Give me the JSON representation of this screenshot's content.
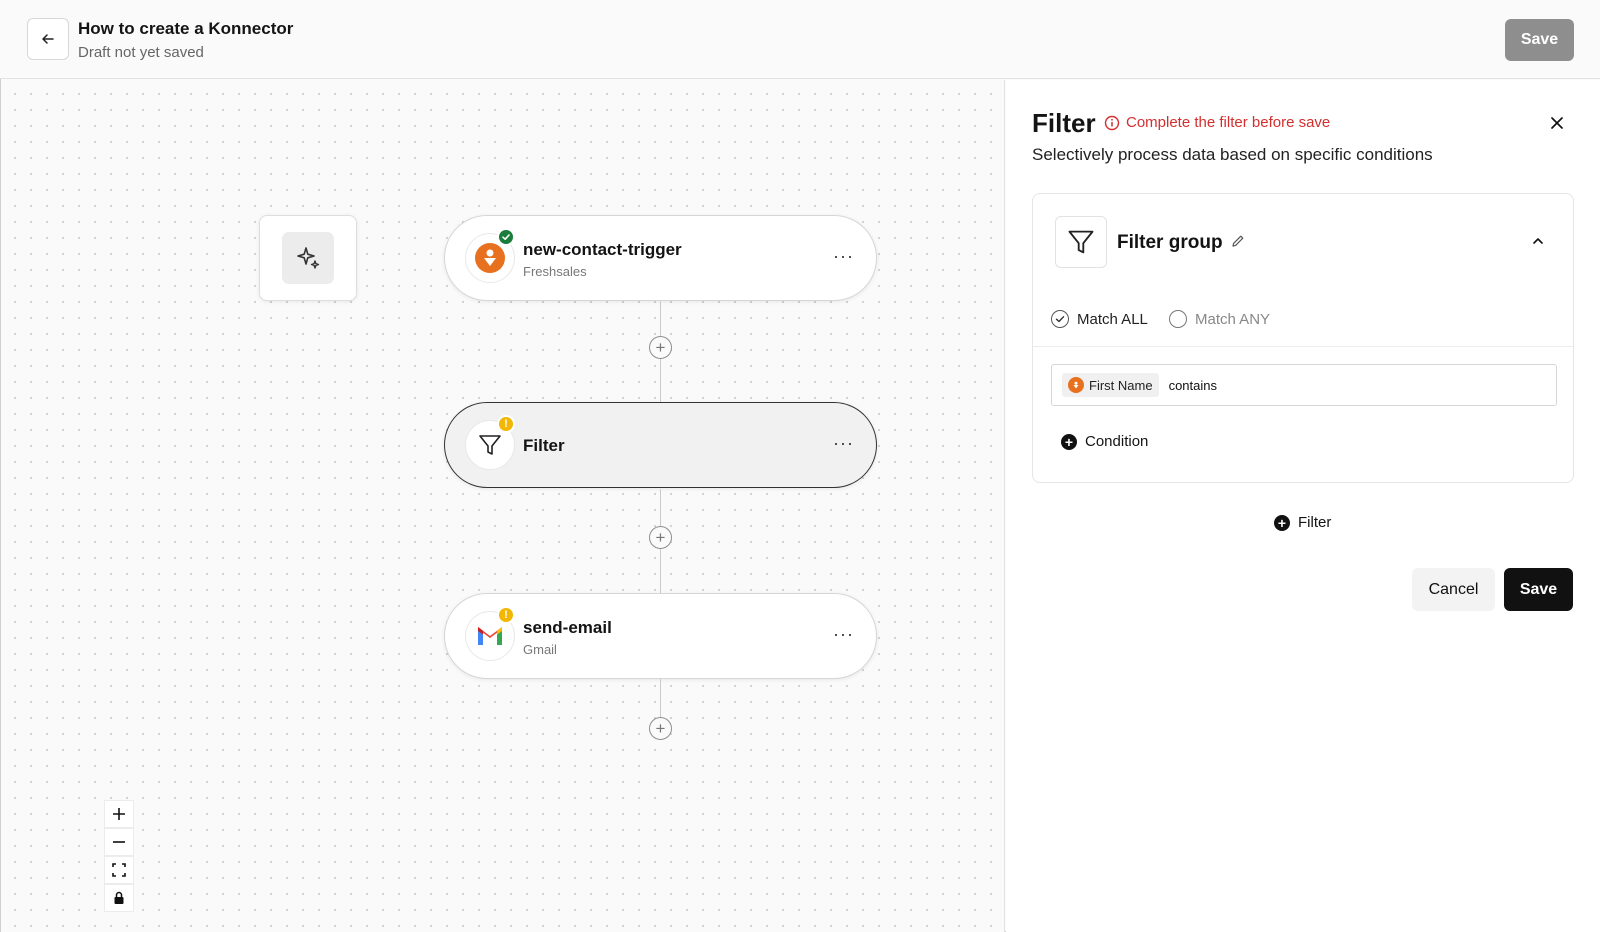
{
  "header": {
    "title": "How to create a Konnector",
    "subtitle": "Draft not yet saved",
    "save_label": "Save"
  },
  "canvas": {
    "nodes": [
      {
        "title": "new-contact-trigger",
        "app": "Freshsales",
        "status": "ok",
        "icon": "freshsales-icon"
      },
      {
        "title": "Filter",
        "app": "",
        "status": "warning",
        "icon": "filter-icon"
      },
      {
        "title": "send-email",
        "app": "Gmail",
        "status": "warning",
        "icon": "gmail-icon"
      }
    ],
    "menu_glyph": "···",
    "zoom_controls": [
      "zoom-in",
      "zoom-out",
      "fit-view",
      "lock"
    ]
  },
  "panel": {
    "title": "Filter",
    "warning": "Complete the filter before save",
    "description": "Selectively process data based on specific conditions",
    "group": {
      "title": "Filter group",
      "match_all_label": "Match ALL",
      "match_any_label": "Match ANY",
      "selected_match": "all",
      "condition": {
        "field": "First Name",
        "operator": "contains",
        "value": ""
      },
      "add_condition_label": "Condition"
    },
    "add_filter_label": "Filter",
    "cancel_label": "Cancel",
    "save_label": "Save"
  },
  "colors": {
    "freshsales_orange": "#e8711f",
    "ok_green": "#1a7d3a",
    "warn_yellow": "#f2b705",
    "error_red": "#d32f2f",
    "disabled_save": "#8e8e8e"
  }
}
